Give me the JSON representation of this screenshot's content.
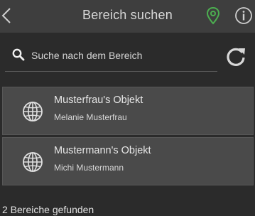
{
  "header": {
    "title": "Bereich suchen",
    "icons": {
      "back": "chevron-left-icon",
      "pin": "map-pin-icon",
      "info": "info-icon"
    },
    "pin_color": "#4caf50"
  },
  "search": {
    "placeholder": "Suche nach dem Bereich",
    "value": "",
    "icons": {
      "search": "search-icon",
      "refresh": "refresh-icon"
    }
  },
  "results": [
    {
      "title": "Musterfrau's Objekt",
      "subtitle": "Melanie Musterfrau",
      "icon": "globe-icon"
    },
    {
      "title": "Mustermann's Objekt",
      "subtitle": "Michi Mustermann",
      "icon": "globe-icon"
    }
  ],
  "status": "2 Bereiche gefunden"
}
